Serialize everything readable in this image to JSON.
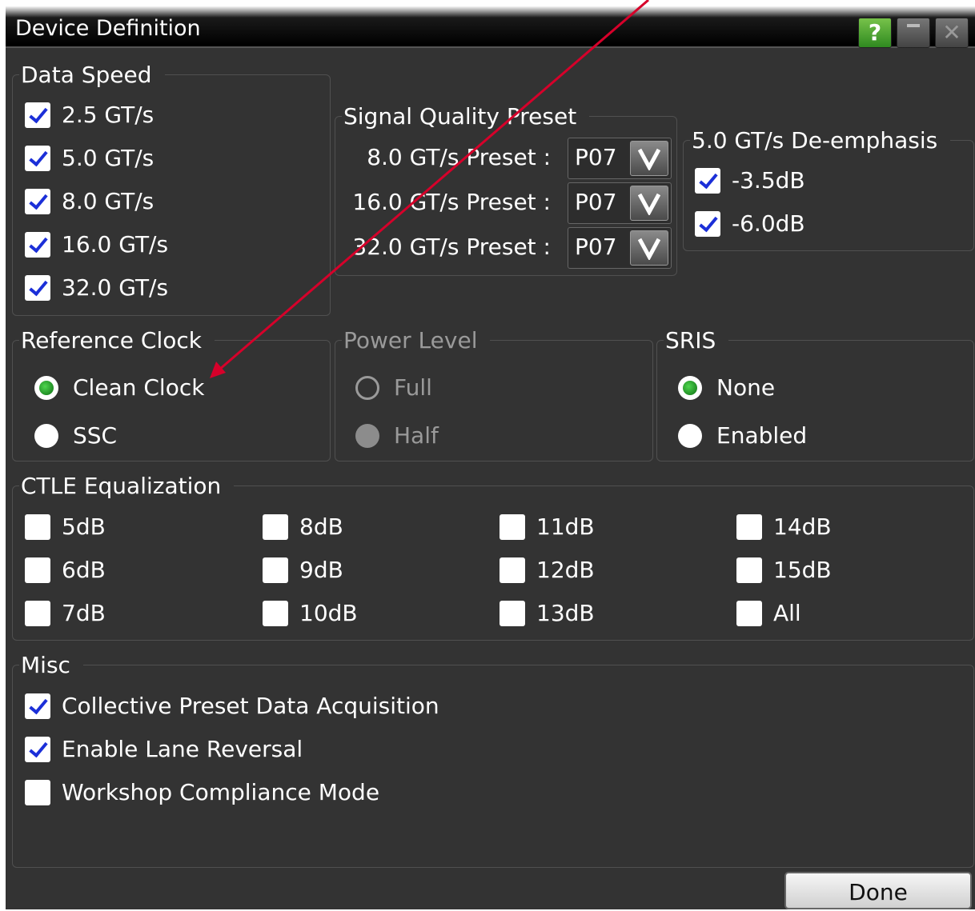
{
  "window": {
    "title": "Device Definition",
    "help_label": "?"
  },
  "data_speed": {
    "legend": "Data Speed",
    "items": [
      {
        "label": "2.5 GT/s",
        "checked": true
      },
      {
        "label": "5.0 GT/s",
        "checked": true
      },
      {
        "label": "8.0 GT/s",
        "checked": true
      },
      {
        "label": "16.0 GT/s",
        "checked": true
      },
      {
        "label": "32.0 GT/s",
        "checked": true
      }
    ]
  },
  "signal_quality": {
    "legend": "Signal Quality Preset",
    "presets": [
      {
        "label": "8.0 GT/s Preset :",
        "value": "P07"
      },
      {
        "label": "16.0 GT/s Preset :",
        "value": "P07"
      },
      {
        "label": "32.0 GT/s Preset :",
        "value": "P07"
      }
    ]
  },
  "deemphasis": {
    "legend": "5.0 GT/s De-emphasis",
    "items": [
      {
        "label": "-3.5dB",
        "checked": true
      },
      {
        "label": "-6.0dB",
        "checked": true
      }
    ]
  },
  "reference_clock": {
    "legend": "Reference Clock",
    "options": [
      {
        "label": "Clean Clock",
        "selected": true
      },
      {
        "label": "SSC",
        "selected": false
      }
    ]
  },
  "power_level": {
    "legend": "Power Level",
    "enabled": false,
    "options": [
      {
        "label": "Full",
        "selected": false
      },
      {
        "label": "Half",
        "selected": true
      }
    ]
  },
  "sris": {
    "legend": "SRIS",
    "options": [
      {
        "label": "None",
        "selected": true
      },
      {
        "label": "Enabled",
        "selected": false
      }
    ]
  },
  "ctle": {
    "legend": "CTLE Equalization",
    "items": [
      "5dB",
      "6dB",
      "7dB",
      "8dB",
      "9dB",
      "10dB",
      "11dB",
      "12dB",
      "13dB",
      "14dB",
      "15dB",
      "All"
    ]
  },
  "misc": {
    "legend": "Misc",
    "items": [
      {
        "label": "Collective Preset Data Acquisition",
        "checked": true
      },
      {
        "label": "Enable Lane Reversal",
        "checked": true
      },
      {
        "label": "Workshop Compliance Mode",
        "checked": false
      }
    ]
  },
  "done_label": "Done",
  "colors": {
    "background": "#333333",
    "check": "#1b2fd8",
    "radio_selected": "#1e9e2a",
    "annotation_arrow": "#d6002a",
    "disabled_text": "#9a9a9a"
  }
}
